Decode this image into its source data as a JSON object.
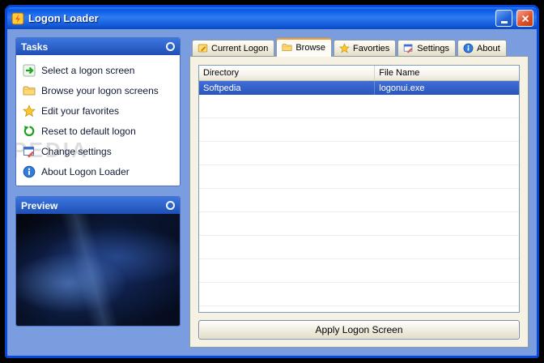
{
  "window": {
    "title": "Logon Loader"
  },
  "sidebar": {
    "tasks": {
      "header": "Tasks",
      "items": [
        {
          "label": "Select a logon screen",
          "icon": "select-arrow-icon"
        },
        {
          "label": "Browse your logon screens",
          "icon": "browse-folder-icon"
        },
        {
          "label": "Edit your favorites",
          "icon": "favorites-star-icon"
        },
        {
          "label": "Reset to default logon",
          "icon": "reset-arrow-icon"
        },
        {
          "label": "Change settings",
          "icon": "change-settings-icon"
        },
        {
          "label": "About Logon Loader",
          "icon": "about-info-icon"
        }
      ]
    },
    "preview": {
      "header": "Preview"
    }
  },
  "tabs": {
    "items": [
      {
        "label": "Current Logon",
        "icon": "current-logon-icon",
        "active": false
      },
      {
        "label": "Browse",
        "icon": "browse-folder-icon",
        "active": true
      },
      {
        "label": "Favorties",
        "icon": "favorites-star-icon",
        "active": false
      },
      {
        "label": "Settings",
        "icon": "settings-icon",
        "active": false
      },
      {
        "label": "About",
        "icon": "about-info-icon",
        "active": false
      }
    ]
  },
  "browse_tab": {
    "columns": [
      "Directory",
      "File Name"
    ],
    "rows": [
      {
        "directory": "Softpedia",
        "file_name": "logonui.exe",
        "selected": true
      }
    ],
    "apply_button": "Apply Logon Screen"
  },
  "watermark": "SOFTPEDIA",
  "icons": {
    "app-icon": "yellow square with orange lightning bolt",
    "minimize-icon": "white underscore bar",
    "close-icon": "white X on red",
    "select-arrow-icon": "green right arrow on white card",
    "browse-folder-icon": "yellow folder",
    "favorites-star-icon": "gold star",
    "reset-arrow-icon": "green curved undo arrow",
    "change-settings-icon": "window with red pencil",
    "about-info-icon": "blue circle with white i",
    "current-logon-icon": "yellow note with pencil",
    "settings-icon": "window with red pencil",
    "panel-header-button": "white ring circle"
  },
  "colors": {
    "titlebar_blue": "#0a57e4",
    "body_blue": "#7a9de0",
    "selection_blue": "#2e59c8",
    "tab_highlight_orange": "#ef9e3f",
    "page_beige": "#f5f2e4"
  }
}
